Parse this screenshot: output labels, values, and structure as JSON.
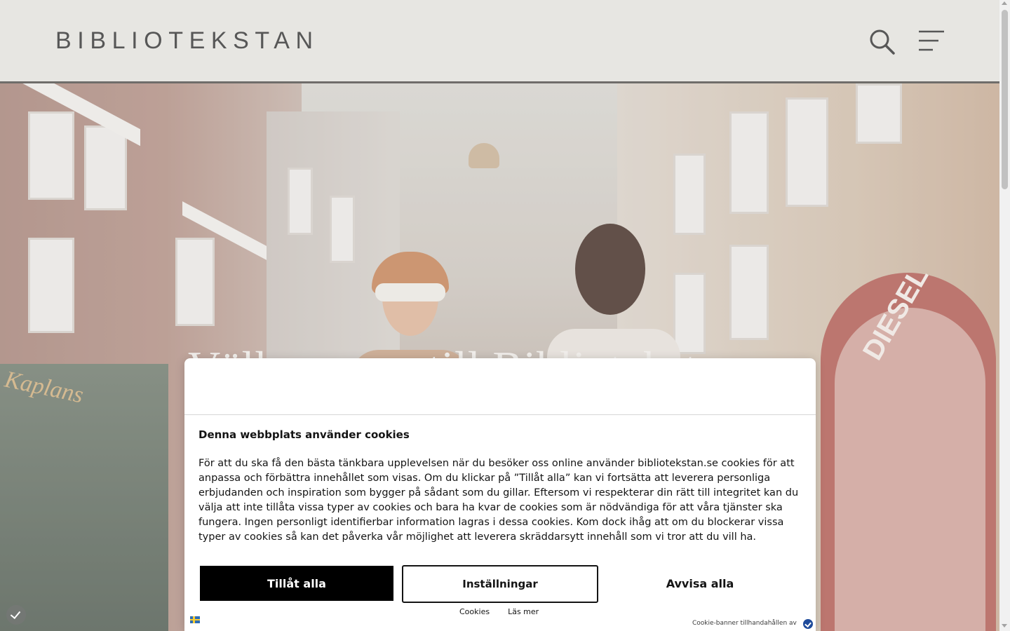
{
  "header": {
    "logo_text": "BIBLIOTEKSTAN",
    "search_icon": "search-icon",
    "menu_icon": "hamburger-menu-icon"
  },
  "hero": {
    "title": "Välkommen till Bibliotekstan",
    "shop_sign_left": "Kaplans",
    "shop_sign_right": "DIESEL"
  },
  "cookie_banner": {
    "title": "Denna webbplats använder cookies",
    "body": "För att du ska få den bästa tänkbara upplevelsen när du besöker oss online använder bibliotekstan.se cookies för att anpassa och förbättra innehållet som visas. Om du klickar på ”Tillåt alla” kan vi fortsätta att leverera personliga erbjudanden och inspiration som bygger på sådant som du gillar. Eftersom vi respekterar din rätt till integritet kan du välja att inte tillåta vissa typer av cookies och bara ha kvar de cookies som är nödvändiga för att våra tjänster ska fungera. Ingen personligt identifierbar information lagras i dessa cookies. Kom dock ihåg att om du blockerar vissa typer av cookies så kan det påverka vår möjlighet att leverera skräddarsytt innehåll som vi tror att du vill ha.",
    "allow_all_label": "Tillåt alla",
    "settings_label": "Inställningar",
    "deny_all_label": "Avvisa alla",
    "link_cookies": "Cookies",
    "link_read_more": "Läs mer",
    "powered_by": "Cookie-banner tillhandahållen av",
    "language_flag": "swedish-flag-icon"
  },
  "colors": {
    "header_bg": "#e7e6e2",
    "logo": "#575757",
    "button_primary_bg": "#000000",
    "button_primary_text": "#ffffff"
  }
}
